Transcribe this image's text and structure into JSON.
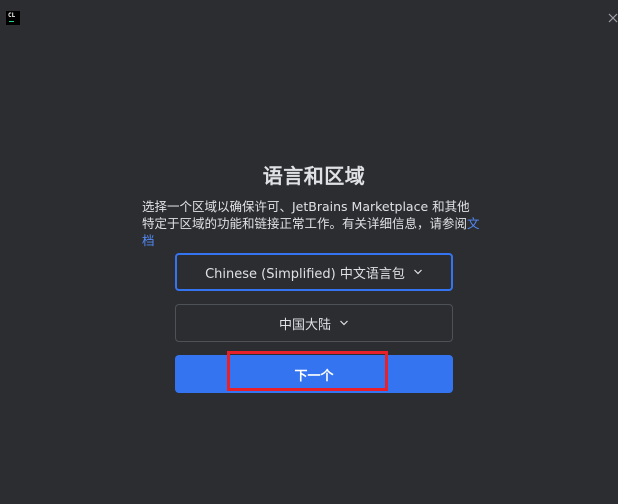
{
  "app": {
    "logo_text": "CL",
    "logo_accent": "#21d789"
  },
  "window": {
    "close_icon": "close-icon"
  },
  "main": {
    "title": "语言和区域",
    "description_text": "选择一个区域以确保许可、JetBrains Marketplace 和其他特定于区域的功能和链接正常工作。有关详细信息，请参阅",
    "description_link": "文档"
  },
  "language_select": {
    "value": "Chinese (Simplified) 中文语言包",
    "icon": "chevron-down-icon"
  },
  "region_select": {
    "value": "中国大陆",
    "icon": "chevron-down-icon"
  },
  "next_button": {
    "label": "下一个"
  },
  "colors": {
    "background": "#2b2d30",
    "accent": "#3574f0",
    "link": "#548af7",
    "highlight": "#e8202a"
  }
}
